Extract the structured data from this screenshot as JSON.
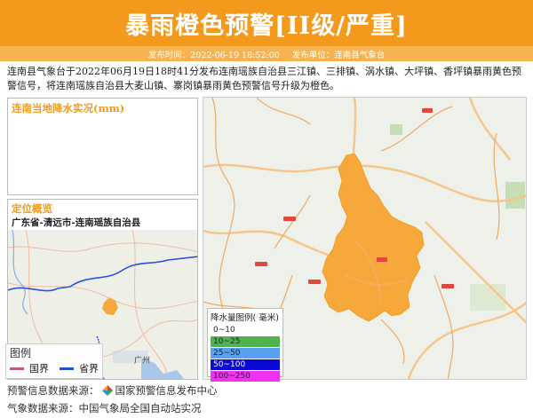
{
  "header": {
    "title": "暴雨橙色预警[II级/严重]"
  },
  "meta": {
    "time": "发布时间：2022-06-19 18:52:00",
    "unit": "发布单位：连南县气象台"
  },
  "description": "连南县气象台于2022年06月19日18时41分发布连南瑶族自治县三江镇、三排镇、涡水镇、大坪镇、香坪镇暴雨黄色预警信号，将连南瑶族自治县大麦山镇、寨岗镇暴雨黄色预警信号升级为橙色。",
  "rain_panel": {
    "title": "连南当地降水实况(mm)"
  },
  "location": {
    "title": "定位概览",
    "path": "广东省-清远市-连南瑶族自治县",
    "city_label": "广州",
    "legend_title": "图例",
    "legend_national": "国界",
    "legend_province": "省界"
  },
  "rain_legend": {
    "title": "降水量图例( 毫米)",
    "items": [
      {
        "label": "0~10",
        "color": "#ffffff"
      },
      {
        "label": "10~25",
        "color": "#4fb34f"
      },
      {
        "label": "25~50",
        "color": "#5aa0f0"
      },
      {
        "label": "50~100",
        "color": "#0a0ad4"
      },
      {
        "label": "100~250",
        "color": "#f032f0"
      }
    ]
  },
  "footer": {
    "source_label": "预警信息数据来源：",
    "source_name": "国家预警信息发布中心",
    "weather_source": "气象数据来源：中国气象局全国自动站实况"
  },
  "colors": {
    "accent": "#f39a1d",
    "accent_light": "#f7b350",
    "warning_area": "#f6a93a"
  },
  "icons": {
    "logo": "diamond-logo-icon"
  }
}
